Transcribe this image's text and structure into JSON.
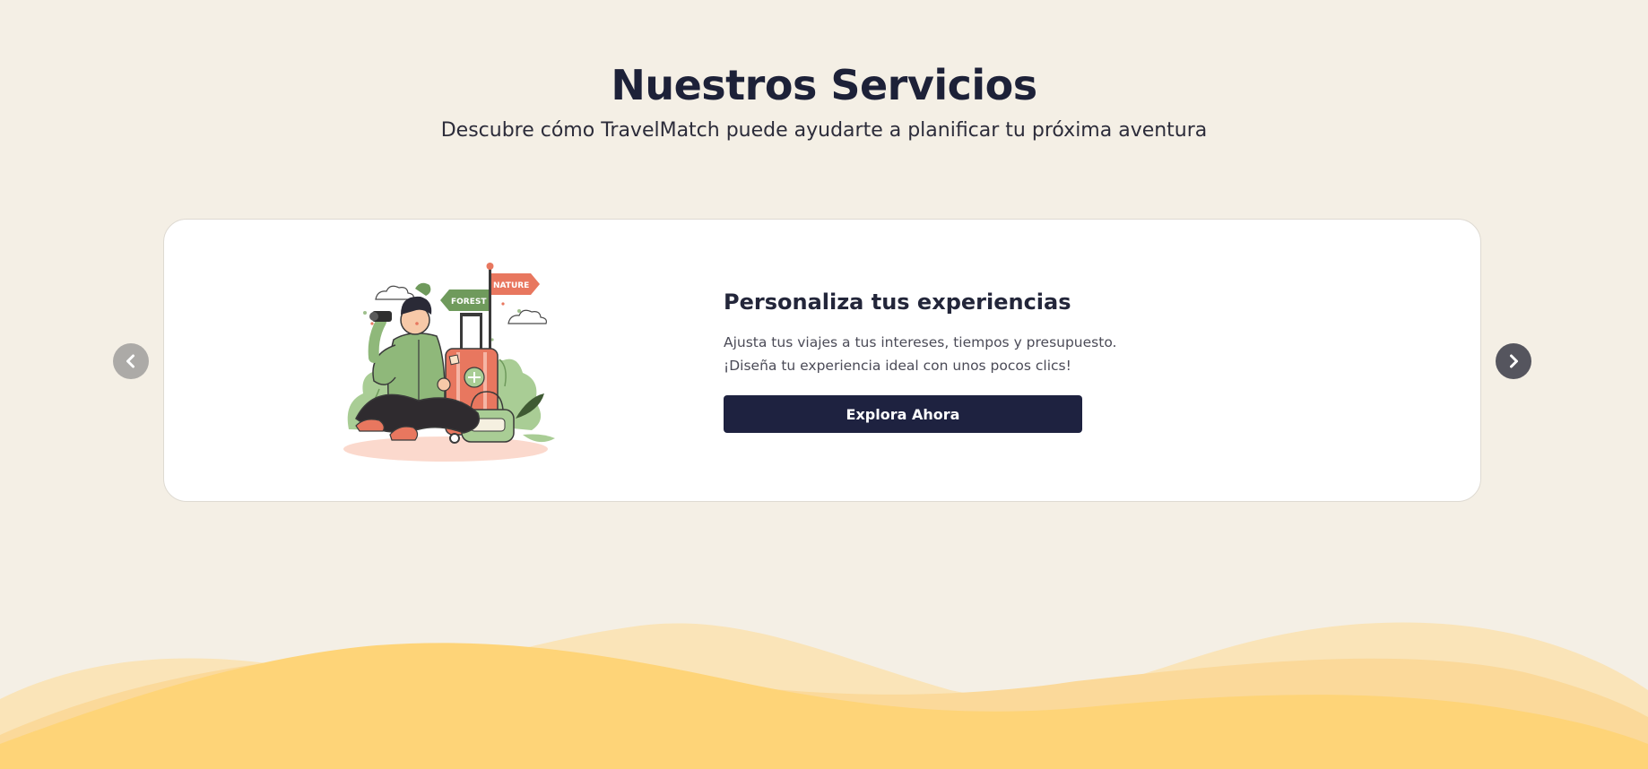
{
  "header": {
    "title": "Nuestros Servicios",
    "subtitle": "Descubre cómo TravelMatch puede ayudarte a planificar tu próxima aventura"
  },
  "slide": {
    "title": "Personaliza tus experiencias",
    "description_line1": "Ajusta tus viajes a tus intereses, tiempos y presupuesto.",
    "description_line2": "¡Diseña tu experiencia ideal con unos pocos clics!",
    "button_label": "Explora Ahora",
    "illustration": {
      "sign_left": "FOREST",
      "sign_right": "NATURE"
    }
  },
  "carousel": {
    "prev_icon": "chevron-left-icon",
    "next_icon": "chevron-right-icon"
  },
  "colors": {
    "background": "#f4efe5",
    "heading": "#1d2138",
    "button": "#1e2240",
    "wave_light": "#fae2b0",
    "wave_dark": "#fed478"
  }
}
